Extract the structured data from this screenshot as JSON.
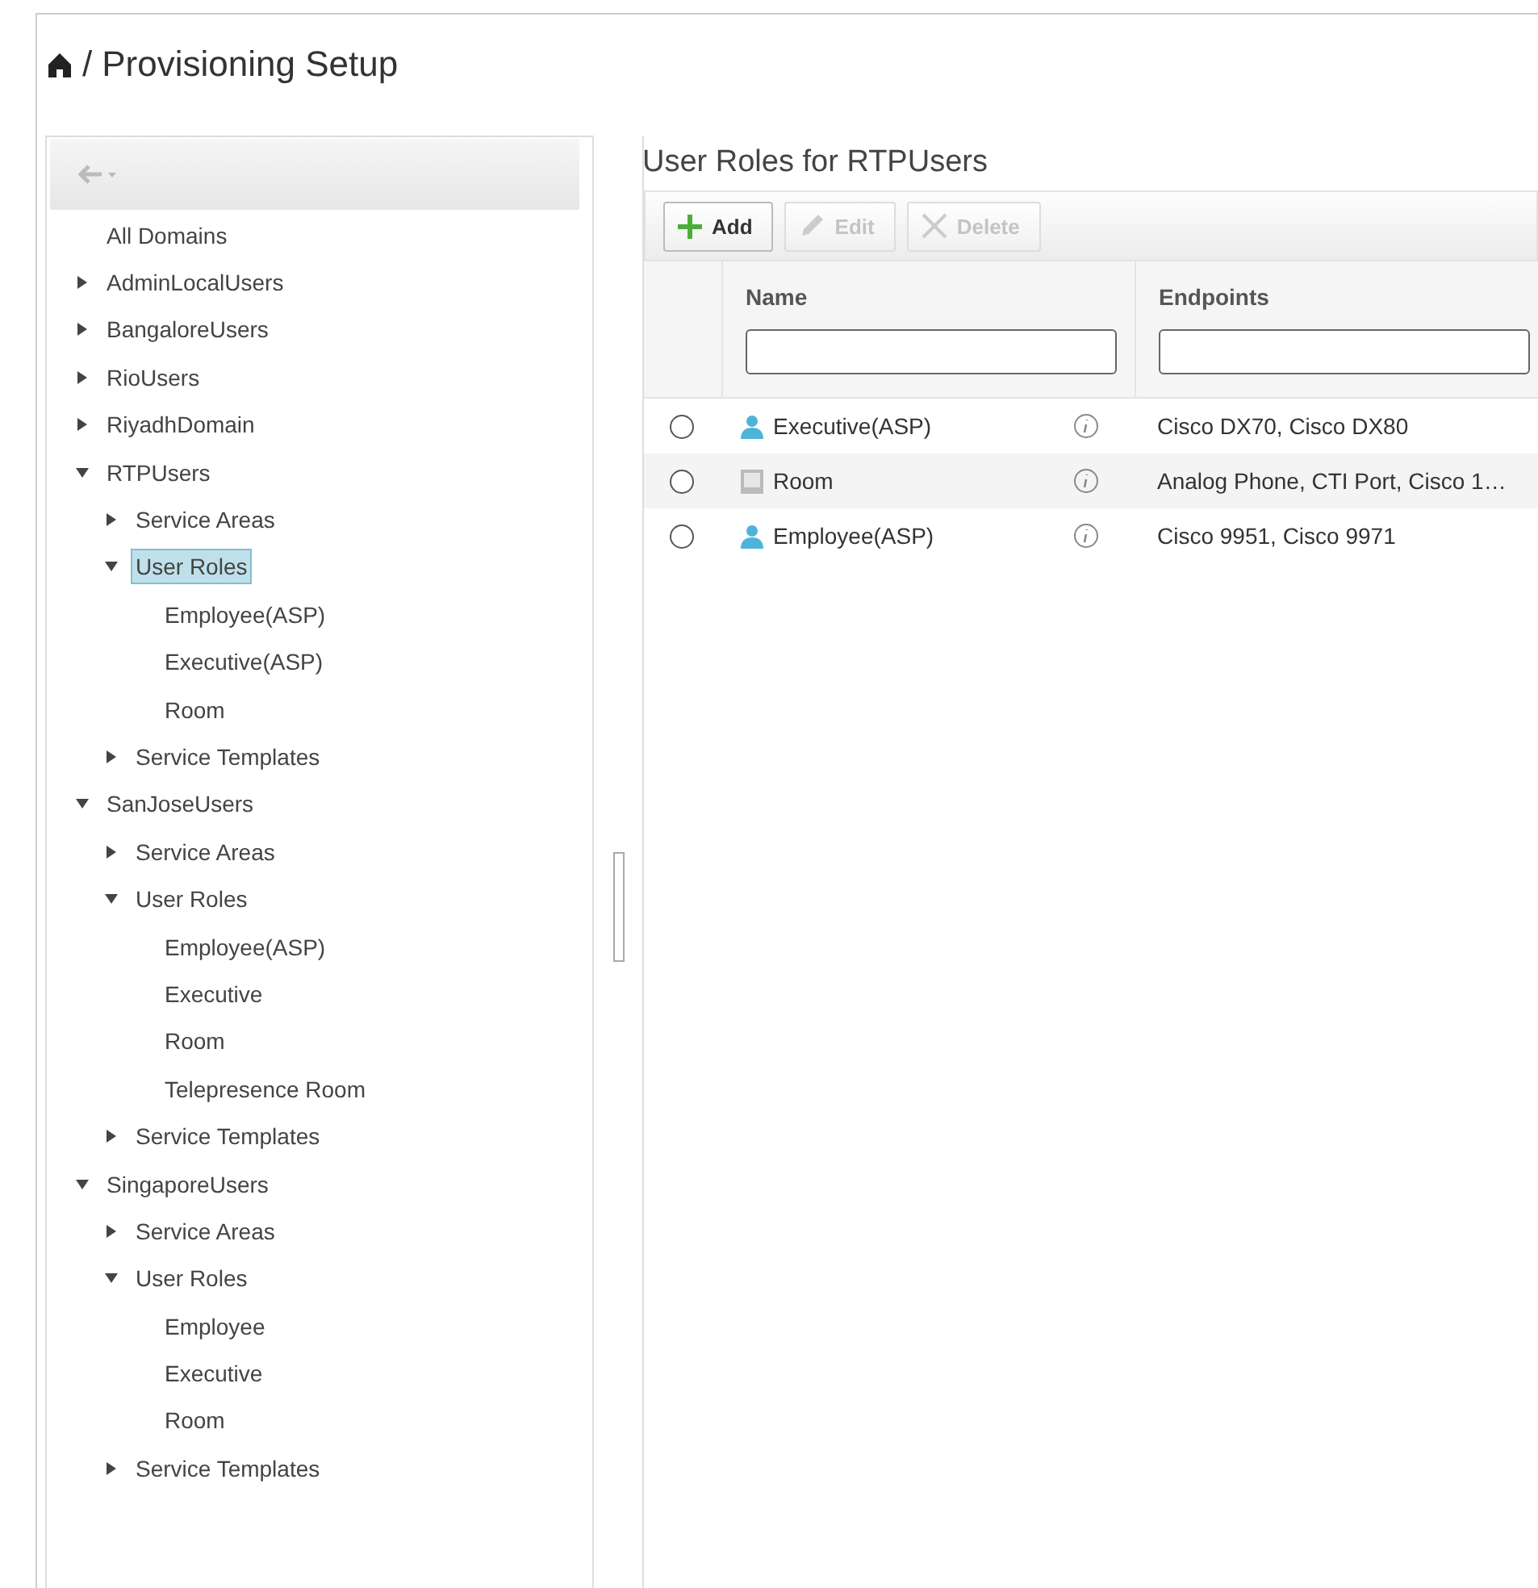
{
  "breadcrumb": {
    "separator": "/",
    "title": "Provisioning Setup"
  },
  "tree": [
    {
      "label": "All Domains",
      "selected": false
    },
    {
      "label": "AdminLocalUsers",
      "expanded": false,
      "selected": false
    },
    {
      "label": "BangaloreUsers",
      "expanded": false,
      "selected": false
    },
    {
      "label": "RioUsers",
      "expanded": false,
      "selected": false
    },
    {
      "label": "RiyadhDomain",
      "expanded": false,
      "selected": false
    },
    {
      "label": "RTPUsers",
      "expanded": true,
      "selected": false,
      "children": [
        {
          "label": "Service Areas",
          "expanded": false,
          "selected": false
        },
        {
          "label": "User Roles",
          "expanded": true,
          "selected": true,
          "children": [
            {
              "label": "Employee(ASP)",
              "selected": false
            },
            {
              "label": "Executive(ASP)",
              "selected": false
            },
            {
              "label": "Room",
              "selected": false
            }
          ]
        },
        {
          "label": "Service Templates",
          "expanded": false,
          "selected": false
        }
      ]
    },
    {
      "label": "SanJoseUsers",
      "expanded": true,
      "selected": false,
      "children": [
        {
          "label": "Service Areas",
          "expanded": false,
          "selected": false
        },
        {
          "label": "User Roles",
          "expanded": true,
          "selected": false,
          "children": [
            {
              "label": "Employee(ASP)",
              "selected": false
            },
            {
              "label": "Executive",
              "selected": false
            },
            {
              "label": "Room",
              "selected": false
            },
            {
              "label": "Telepresence Room",
              "selected": false
            }
          ]
        },
        {
          "label": "Service Templates",
          "expanded": false,
          "selected": false
        }
      ]
    },
    {
      "label": "SingaporeUsers",
      "expanded": true,
      "selected": false,
      "children": [
        {
          "label": "Service Areas",
          "expanded": false,
          "selected": false
        },
        {
          "label": "User Roles",
          "expanded": true,
          "selected": false,
          "children": [
            {
              "label": "Employee",
              "selected": false
            },
            {
              "label": "Executive",
              "selected": false
            },
            {
              "label": "Room",
              "selected": false
            }
          ]
        },
        {
          "label": "Service Templates",
          "expanded": false,
          "selected": false
        }
      ]
    }
  ],
  "panel": {
    "title": "User Roles for RTPUsers",
    "toolbar": [
      {
        "kind": "add",
        "label": "Add",
        "disabled": false
      },
      {
        "kind": "edit",
        "label": "Edit",
        "disabled": true
      },
      {
        "kind": "delete",
        "label": "Delete",
        "disabled": true
      }
    ],
    "columns": [
      "Name",
      "Endpoints"
    ],
    "rows": [
      {
        "kind": "person",
        "name": "Executive(ASP)",
        "endpoints": "Cisco DX70, Cisco DX80",
        "selected": false
      },
      {
        "kind": "room",
        "name": "Room",
        "endpoints": "Analog Phone, CTI Port, Cisco 1…",
        "selected": false
      },
      {
        "kind": "person",
        "name": "Employee(ASP)",
        "endpoints": "Cisco 9951, Cisco 9971",
        "selected": false
      }
    ]
  }
}
